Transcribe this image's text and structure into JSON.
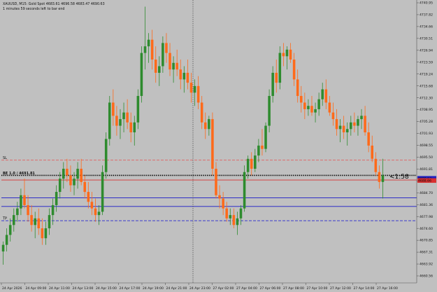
{
  "header": {
    "symbol_line": "XAUUSD, M15: Gold Spot  4683.61 4696.58 4683.47 4690.63",
    "timer_line": "1 minutes 59 seconds left to bar end"
  },
  "overlay": {
    "sl_label": "SL",
    "tp_label": "TP",
    "countdown": "<1:58",
    "dotted_label": "BE 1.0 / 4691.81"
  },
  "colors": {
    "background": "#c0c0c0",
    "bull": "#2e8b2e",
    "bear": "#ff6a1a",
    "sl_line": "#e06060",
    "tp_line": "#2a2ad0",
    "level_red": "#d83030",
    "level_blue": "#1818c8",
    "dotted": "#000000",
    "current_price_box": "#2020c0",
    "bid_box": "#d83030"
  },
  "price_axis": {
    "ticks": [
      "4740.95",
      "4737.82",
      "4734.66",
      "4730.51",
      "4726.94",
      "4723.59",
      "4719.24",
      "4715.68",
      "4712.30",
      "4708.95",
      "4705.28",
      "4701.93",
      "4698.55",
      "4695.50",
      "4691.81",
      "4688.47",
      "4684.70",
      "4681.36",
      "4677.98",
      "4674.60",
      "4670.85",
      "4667.31",
      "4663.92",
      "4660.56"
    ],
    "current_price": "4690.63",
    "bid_label": "4688.66"
  },
  "time_axis": {
    "ticks": [
      "24 Apr 2026",
      "24 Apr 09:00",
      "24 Apr 11:00",
      "24 Apr 13:00",
      "24 Apr 15:00",
      "24 Apr 17:00",
      "24 Apr 19:00",
      "24 Apr 21:00",
      "24 Apr 23:00",
      "27 Apr 02:00",
      "27 Apr 04:00",
      "27 Apr 06:00",
      "27 Apr 08:00",
      "27 Apr 10:00",
      "27 Apr 12:00",
      "27 Apr 14:00",
      "27 Apr 16:00"
    ]
  },
  "chart_data": {
    "type": "candlestick",
    "symbol": "XAUUSD",
    "timeframe": "M15",
    "ylim": [
      4657.5,
      4743.0
    ],
    "levels": {
      "sl": 4694.6,
      "tp": 4676.3,
      "dotted": 4690.0,
      "red": 4688.6,
      "blue_upper": 4683.2,
      "blue_lower": 4680.6
    },
    "candles": [
      {
        "o": 4667,
        "h": 4670,
        "l": 4663,
        "c": 4669
      },
      {
        "o": 4669,
        "h": 4674,
        "l": 4667,
        "c": 4672
      },
      {
        "o": 4672,
        "h": 4677,
        "l": 4670,
        "c": 4675
      },
      {
        "o": 4675,
        "h": 4680,
        "l": 4673,
        "c": 4678
      },
      {
        "o": 4678,
        "h": 4682,
        "l": 4676,
        "c": 4680
      },
      {
        "o": 4680,
        "h": 4686,
        "l": 4678,
        "c": 4684
      },
      {
        "o": 4684,
        "h": 4689,
        "l": 4680,
        "c": 4681
      },
      {
        "o": 4681,
        "h": 4684,
        "l": 4676,
        "c": 4678
      },
      {
        "o": 4678,
        "h": 4681,
        "l": 4673,
        "c": 4675
      },
      {
        "o": 4675,
        "h": 4679,
        "l": 4671,
        "c": 4677
      },
      {
        "o": 4677,
        "h": 4680,
        "l": 4672,
        "c": 4674
      },
      {
        "o": 4674,
        "h": 4677,
        "l": 4669,
        "c": 4671
      },
      {
        "o": 4671,
        "h": 4676,
        "l": 4669,
        "c": 4674
      },
      {
        "o": 4674,
        "h": 4680,
        "l": 4672,
        "c": 4678
      },
      {
        "o": 4678,
        "h": 4683,
        "l": 4675,
        "c": 4681
      },
      {
        "o": 4681,
        "h": 4687,
        "l": 4679,
        "c": 4685
      },
      {
        "o": 4685,
        "h": 4691,
        "l": 4683,
        "c": 4689
      },
      {
        "o": 4689,
        "h": 4694,
        "l": 4686,
        "c": 4692
      },
      {
        "o": 4692,
        "h": 4695,
        "l": 4688,
        "c": 4690
      },
      {
        "o": 4690,
        "h": 4693,
        "l": 4685,
        "c": 4687
      },
      {
        "o": 4687,
        "h": 4691,
        "l": 4684,
        "c": 4689
      },
      {
        "o": 4689,
        "h": 4694,
        "l": 4686,
        "c": 4692
      },
      {
        "o": 4692,
        "h": 4695,
        "l": 4687,
        "c": 4688
      },
      {
        "o": 4688,
        "h": 4690,
        "l": 4683,
        "c": 4685
      },
      {
        "o": 4685,
        "h": 4688,
        "l": 4680,
        "c": 4682
      },
      {
        "o": 4682,
        "h": 4685,
        "l": 4678,
        "c": 4680
      },
      {
        "o": 4680,
        "h": 4683,
        "l": 4676,
        "c": 4678
      },
      {
        "o": 4678,
        "h": 4681,
        "l": 4675,
        "c": 4679
      },
      {
        "o": 4679,
        "h": 4693,
        "l": 4678,
        "c": 4691
      },
      {
        "o": 4691,
        "h": 4703,
        "l": 4689,
        "c": 4701
      },
      {
        "o": 4701,
        "h": 4714,
        "l": 4699,
        "c": 4712
      },
      {
        "o": 4712,
        "h": 4716,
        "l": 4705,
        "c": 4708
      },
      {
        "o": 4708,
        "h": 4711,
        "l": 4702,
        "c": 4705
      },
      {
        "o": 4705,
        "h": 4710,
        "l": 4701,
        "c": 4707
      },
      {
        "o": 4707,
        "h": 4712,
        "l": 4703,
        "c": 4709
      },
      {
        "o": 4709,
        "h": 4713,
        "l": 4704,
        "c": 4706
      },
      {
        "o": 4706,
        "h": 4709,
        "l": 4700,
        "c": 4703
      },
      {
        "o": 4703,
        "h": 4708,
        "l": 4699,
        "c": 4706
      },
      {
        "o": 4706,
        "h": 4716,
        "l": 4704,
        "c": 4714
      },
      {
        "o": 4714,
        "h": 4729,
        "l": 4712,
        "c": 4727
      },
      {
        "o": 4727,
        "h": 4741,
        "l": 4722,
        "c": 4729
      },
      {
        "o": 4729,
        "h": 4733,
        "l": 4724,
        "c": 4731
      },
      {
        "o": 4731,
        "h": 4734,
        "l": 4722,
        "c": 4725
      },
      {
        "o": 4725,
        "h": 4729,
        "l": 4718,
        "c": 4721
      },
      {
        "o": 4721,
        "h": 4726,
        "l": 4717,
        "c": 4723
      },
      {
        "o": 4723,
        "h": 4732,
        "l": 4721,
        "c": 4730
      },
      {
        "o": 4730,
        "h": 4733,
        "l": 4724,
        "c": 4727
      },
      {
        "o": 4727,
        "h": 4730,
        "l": 4720,
        "c": 4722
      },
      {
        "o": 4722,
        "h": 4726,
        "l": 4718,
        "c": 4724
      },
      {
        "o": 4724,
        "h": 4728,
        "l": 4720,
        "c": 4722
      },
      {
        "o": 4722,
        "h": 4725,
        "l": 4716,
        "c": 4719
      },
      {
        "o": 4719,
        "h": 4723,
        "l": 4715,
        "c": 4721
      },
      {
        "o": 4721,
        "h": 4725,
        "l": 4716,
        "c": 4718
      },
      {
        "o": 4718,
        "h": 4721,
        "l": 4712,
        "c": 4715
      },
      {
        "o": 4715,
        "h": 4719,
        "l": 4711,
        "c": 4717
      },
      {
        "o": 4717,
        "h": 4720,
        "l": 4710,
        "c": 4712
      },
      {
        "o": 4712,
        "h": 4714,
        "l": 4704,
        "c": 4706
      },
      {
        "o": 4706,
        "h": 4709,
        "l": 4701,
        "c": 4704
      },
      {
        "o": 4704,
        "h": 4708,
        "l": 4702,
        "c": 4707
      },
      {
        "o": 4707,
        "h": 4709,
        "l": 4690,
        "c": 4692
      },
      {
        "o": 4692,
        "h": 4694,
        "l": 4683,
        "c": 4684
      },
      {
        "o": 4684,
        "h": 4687,
        "l": 4680,
        "c": 4683
      },
      {
        "o": 4683,
        "h": 4685,
        "l": 4678,
        "c": 4680
      },
      {
        "o": 4680,
        "h": 4682,
        "l": 4676,
        "c": 4677
      },
      {
        "o": 4677,
        "h": 4680,
        "l": 4675,
        "c": 4678
      },
      {
        "o": 4678,
        "h": 4680,
        "l": 4674,
        "c": 4675
      },
      {
        "o": 4675,
        "h": 4679,
        "l": 4672,
        "c": 4677
      },
      {
        "o": 4677,
        "h": 4681,
        "l": 4675,
        "c": 4680
      },
      {
        "o": 4680,
        "h": 4693,
        "l": 4679,
        "c": 4691
      },
      {
        "o": 4691,
        "h": 4696,
        "l": 4689,
        "c": 4695
      },
      {
        "o": 4695,
        "h": 4697,
        "l": 4690,
        "c": 4692
      },
      {
        "o": 4692,
        "h": 4698,
        "l": 4691,
        "c": 4696
      },
      {
        "o": 4696,
        "h": 4701,
        "l": 4694,
        "c": 4699
      },
      {
        "o": 4699,
        "h": 4704,
        "l": 4696,
        "c": 4698
      },
      {
        "o": 4698,
        "h": 4706,
        "l": 4697,
        "c": 4705
      },
      {
        "o": 4705,
        "h": 4716,
        "l": 4703,
        "c": 4714
      },
      {
        "o": 4714,
        "h": 4723,
        "l": 4712,
        "c": 4721
      },
      {
        "o": 4721,
        "h": 4725,
        "l": 4715,
        "c": 4718
      },
      {
        "o": 4718,
        "h": 4729,
        "l": 4716,
        "c": 4727
      },
      {
        "o": 4727,
        "h": 4730,
        "l": 4723,
        "c": 4726
      },
      {
        "o": 4726,
        "h": 4729,
        "l": 4722,
        "c": 4728
      },
      {
        "o": 4728,
        "h": 4730,
        "l": 4724,
        "c": 4725
      },
      {
        "o": 4725,
        "h": 4727,
        "l": 4717,
        "c": 4719
      },
      {
        "o": 4719,
        "h": 4722,
        "l": 4712,
        "c": 4714
      },
      {
        "o": 4714,
        "h": 4717,
        "l": 4709,
        "c": 4712
      },
      {
        "o": 4712,
        "h": 4715,
        "l": 4707,
        "c": 4710
      },
      {
        "o": 4710,
        "h": 4713,
        "l": 4708,
        "c": 4711
      },
      {
        "o": 4711,
        "h": 4714,
        "l": 4708,
        "c": 4709
      },
      {
        "o": 4709,
        "h": 4712,
        "l": 4706,
        "c": 4710
      },
      {
        "o": 4710,
        "h": 4715,
        "l": 4708,
        "c": 4713
      },
      {
        "o": 4713,
        "h": 4718,
        "l": 4711,
        "c": 4716
      },
      {
        "o": 4716,
        "h": 4719,
        "l": 4710,
        "c": 4712
      },
      {
        "o": 4712,
        "h": 4714,
        "l": 4708,
        "c": 4709
      },
      {
        "o": 4709,
        "h": 4712,
        "l": 4705,
        "c": 4707
      },
      {
        "o": 4707,
        "h": 4710,
        "l": 4702,
        "c": 4704
      },
      {
        "o": 4704,
        "h": 4707,
        "l": 4700,
        "c": 4705
      },
      {
        "o": 4705,
        "h": 4708,
        "l": 4701,
        "c": 4703
      },
      {
        "o": 4703,
        "h": 4706,
        "l": 4699,
        "c": 4704
      },
      {
        "o": 4704,
        "h": 4708,
        "l": 4702,
        "c": 4706
      },
      {
        "o": 4706,
        "h": 4709,
        "l": 4703,
        "c": 4705
      },
      {
        "o": 4705,
        "h": 4708,
        "l": 4702,
        "c": 4707
      },
      {
        "o": 4707,
        "h": 4710,
        "l": 4704,
        "c": 4708
      },
      {
        "o": 4708,
        "h": 4711,
        "l": 4702,
        "c": 4703
      },
      {
        "o": 4703,
        "h": 4706,
        "l": 4697,
        "c": 4699
      },
      {
        "o": 4699,
        "h": 4702,
        "l": 4694,
        "c": 4695
      },
      {
        "o": 4695,
        "h": 4697,
        "l": 4690,
        "c": 4691
      },
      {
        "o": 4691,
        "h": 4693,
        "l": 4686,
        "c": 4688
      },
      {
        "o": 4688,
        "h": 4695,
        "l": 4683,
        "c": 4690
      }
    ]
  }
}
